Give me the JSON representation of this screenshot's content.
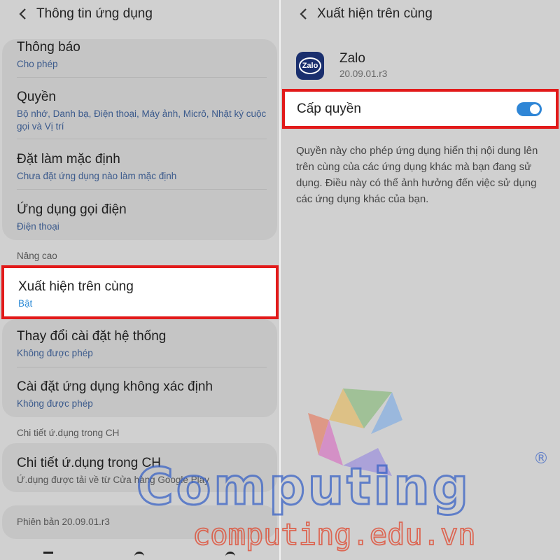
{
  "left": {
    "header_title": "Thông tin ứng dụng",
    "items": [
      {
        "title": "Thông báo",
        "subtitle": "Cho phép"
      },
      {
        "title": "Quyền",
        "subtitle": "Bộ nhớ, Danh bạ, Điện thoại, Máy ảnh, Micrô, Nhật ký cuộc gọi và Vị trí"
      },
      {
        "title": "Đặt làm mặc định",
        "subtitle": "Chưa đặt ứng dụng nào làm mặc định"
      },
      {
        "title": "Ứng dụng gọi điện",
        "subtitle": "Điện thoại"
      }
    ],
    "section_advanced": "Nâng cao",
    "highlighted_item": {
      "title": "Xuất hiện trên cùng",
      "subtitle": "Bật"
    },
    "advanced_items": [
      {
        "title": "Thay đổi cài đặt hệ thống",
        "subtitle": "Không được phép"
      },
      {
        "title": "Cài đặt ứng dụng không xác định",
        "subtitle": "Không được phép"
      }
    ],
    "section_store": "Chi tiết ứ.dụng trong CH",
    "store_item": {
      "title": "Chi tiết ứ.dụng trong CH",
      "subtitle": "Ứ.dụng được tải về từ Cửa hàng Google Play"
    },
    "version": "Phiên bản 20.09.01.r3"
  },
  "right": {
    "header_title": "Xuất hiện trên cùng",
    "app_name": "Zalo",
    "app_icon_text": "Zalo",
    "app_version": "20.09.01.r3",
    "permission_label": "Cấp quyền",
    "permission_enabled": true,
    "description": "Quyền này cho phép ứng dụng hiển thị nội dung lên trên cùng của các ứng dụng khác mà bạn đang sử dụng. Điều này có thể ảnh hưởng đến việc sử dụng các ứng dụng khác của bạn."
  },
  "watermark": {
    "brand": "Computing",
    "registered": "®",
    "url": "computing.edu.vn"
  },
  "colors": {
    "highlight_border": "#e21a1a",
    "toggle_on": "#2f86d6",
    "link_blue": "#3b5a8c",
    "watermark_blue": "#3a63c6",
    "watermark_red": "#e0452b"
  },
  "icons": [
    "back-arrow-icon",
    "zalo-app-icon",
    "toggle-switch"
  ]
}
